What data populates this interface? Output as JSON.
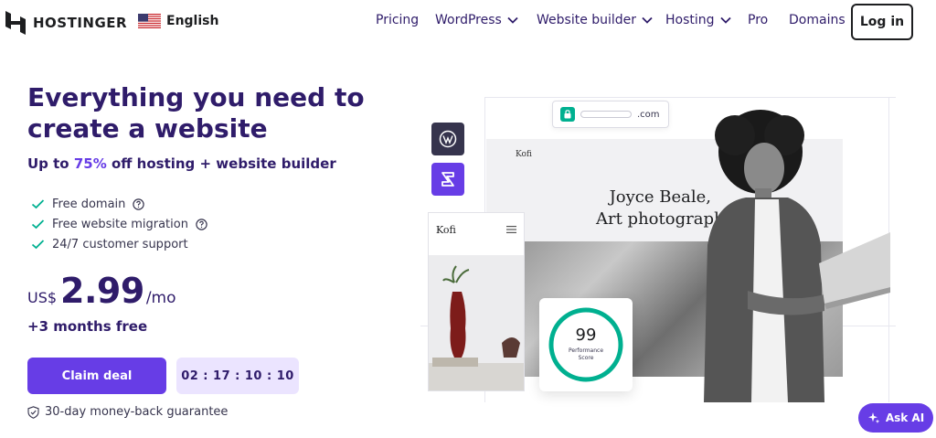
{
  "header": {
    "brand": "HOSTINGER",
    "language": "English",
    "nav": [
      {
        "label": "Pricing",
        "has_menu": false
      },
      {
        "label": "WordPress",
        "has_menu": true
      },
      {
        "label": "Website builder",
        "has_menu": true
      },
      {
        "label": "Hosting",
        "has_menu": true
      },
      {
        "label": "Pro",
        "has_menu": false
      },
      {
        "label": "Domains",
        "has_menu": false
      }
    ],
    "login_label": "Log in"
  },
  "hero": {
    "title": "Everything you need to create a website",
    "subtitle_prefix": "Up to ",
    "subtitle_accent": "75%",
    "subtitle_suffix": " off hosting + website builder",
    "features": [
      {
        "label": "Free domain",
        "has_help": true
      },
      {
        "label": "Free website migration",
        "has_help": true
      },
      {
        "label": "24/7 customer support",
        "has_help": false
      }
    ],
    "currency": "US$",
    "price": "2.99",
    "period": "/mo",
    "bonus": "+3 months free",
    "claim_label": "Claim deal",
    "timer": "02 : 17 : 10 : 10",
    "guarantee": "30-day money-back guarantee"
  },
  "illustration": {
    "url_text": ".com",
    "site_brand": "Kofi",
    "site_headline_line1": "Joyce Beale,",
    "site_headline_line2": "Art photograph",
    "mobile_brand": "Kofi",
    "score_value": "99",
    "score_label_line1": "Performance",
    "score_label_line2": "Score"
  },
  "ask_ai_label": "Ask AI",
  "colors": {
    "brand_purple": "#673de6",
    "navy": "#2f1c6a",
    "success_green": "#00b090",
    "timer_bg": "#ebe4ff"
  }
}
